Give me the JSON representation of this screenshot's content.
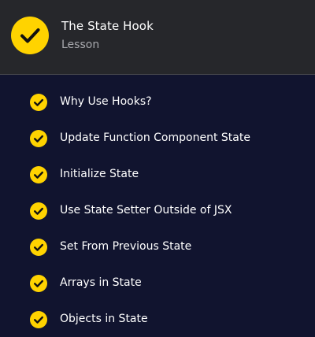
{
  "header": {
    "title": "The State Hook",
    "subtitle": "Lesson",
    "status_icon": "checkmark-icon",
    "accent_color": "#ffd300"
  },
  "items": [
    {
      "label": "Why Use Hooks?",
      "completed": true
    },
    {
      "label": "Update Function Component State",
      "completed": true
    },
    {
      "label": "Initialize State",
      "completed": true
    },
    {
      "label": "Use State Setter Outside of JSX",
      "completed": true
    },
    {
      "label": "Set From Previous State",
      "completed": true
    },
    {
      "label": "Arrays in State",
      "completed": true
    },
    {
      "label": "Objects in State",
      "completed": true
    }
  ],
  "colors": {
    "header_background": "#26272b",
    "list_background": "#11142f",
    "check_color": "#ffd300",
    "text_color": "#ffffff",
    "subtitle_color": "#a7a8ad"
  }
}
